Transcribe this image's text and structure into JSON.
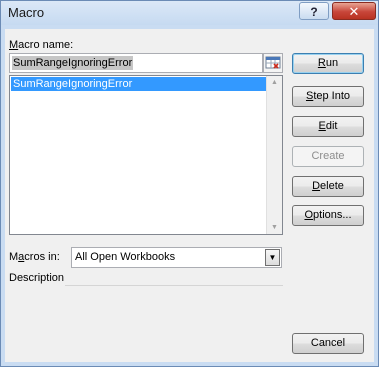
{
  "window": {
    "title": "Macro",
    "help_label": "?",
    "close_label": "✕"
  },
  "macro_name": {
    "label": "Macro name:",
    "value": "SumRangeIgnoringError"
  },
  "macro_list": {
    "items": [
      "SumRangeIgnoringError"
    ],
    "selected_index": 0
  },
  "macros_in": {
    "label": "Macros in:",
    "value": "All Open Workbooks"
  },
  "description": {
    "label": "Description"
  },
  "buttons": {
    "run": "Run",
    "step_into": "Step Into",
    "edit": "Edit",
    "create": "Create",
    "delete": "Delete",
    "options": "Options...",
    "cancel": "Cancel"
  },
  "icons": {
    "collapse_dialog": "range-picker-icon",
    "scroll_up": "chevron-up-icon",
    "scroll_down": "chevron-down-icon",
    "dropdown": "chevron-down-icon"
  }
}
